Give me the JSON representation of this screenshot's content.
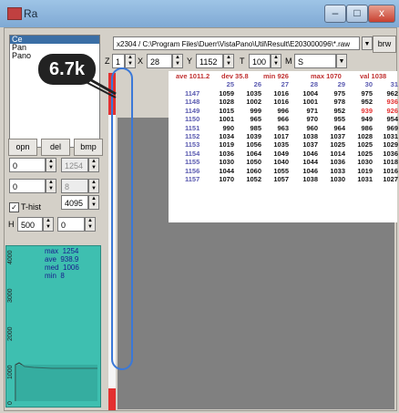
{
  "window": {
    "title": "Ra",
    "minimize_glyph": "–",
    "maximize_glyph": "□",
    "close_glyph": "x"
  },
  "colors": {
    "accent": "#3a6ea5",
    "value_red": "#e43030",
    "header_blue": "#3a3a9c",
    "histogram_bg": "#3ebfb0"
  },
  "file_list": [
    {
      "label": "Ce",
      "selected": true
    },
    {
      "label": "Pan",
      "selected": false
    },
    {
      "label": "Pano",
      "selected": false
    }
  ],
  "path_field": {
    "value": "x2304 / C:\\Program Files\\Duerr\\VistaPano\\Util\\Result\\E203000096\\*.raw"
  },
  "browse_button": {
    "label": "brw"
  },
  "params": {
    "z_label": "Z",
    "z_value": "1",
    "x_label": "X",
    "x_value": "28",
    "y_label": "Y",
    "y_value": "1152",
    "t_label": "T",
    "t_value": "100",
    "m_label": "M",
    "m_value": "S"
  },
  "buttons": {
    "open": "opn",
    "delete": "del",
    "bmp": "bmp"
  },
  "fields": {
    "field_a": "0",
    "field_b": "1254",
    "field_c": "0",
    "field_d": "8",
    "thist_label": "T-hist",
    "thist_checked": true,
    "thist_value": "4095",
    "h_label": "H",
    "h_value": "500",
    "h_offset": "0"
  },
  "histogram": {
    "max_label": "max",
    "max_value": "1254",
    "ave_label": "ave",
    "ave_value": "938.9",
    "med_label": "med",
    "med_value": "1006",
    "min_label": "min",
    "min_value": "8",
    "ticks": [
      "4000",
      "3000",
      "2000",
      "1000",
      "0"
    ]
  },
  "stats": {
    "ave_label": "ave",
    "ave_value": "1011.2",
    "dev_label": "dev",
    "dev_value": "35.8",
    "min_label": "min",
    "min_value": "926",
    "max_label": "max",
    "max_value": "1070",
    "val_label": "val",
    "val_value": "1038"
  },
  "table": {
    "columns": [
      "25",
      "26",
      "27",
      "28",
      "29",
      "30",
      "31"
    ],
    "rows": [
      {
        "id": "1147",
        "cells": [
          "1059",
          "1035",
          "1016",
          "1004",
          "975",
          "975",
          "962"
        ]
      },
      {
        "id": "1148",
        "cells": [
          "1028",
          "1002",
          "1016",
          "1001",
          "978",
          "952",
          "936"
        ]
      },
      {
        "id": "1149",
        "cells": [
          "1015",
          "999",
          "996",
          "971",
          "952",
          "939",
          "926"
        ]
      },
      {
        "id": "1150",
        "cells": [
          "1001",
          "965",
          "966",
          "970",
          "955",
          "949",
          "954"
        ]
      },
      {
        "id": "1151",
        "cells": [
          "990",
          "985",
          "963",
          "960",
          "964",
          "986",
          "969"
        ]
      },
      {
        "id": "1152",
        "cells": [
          "1034",
          "1039",
          "1017",
          "1038",
          "1037",
          "1028",
          "1031"
        ]
      },
      {
        "id": "1153",
        "cells": [
          "1019",
          "1056",
          "1035",
          "1037",
          "1025",
          "1025",
          "1029"
        ]
      },
      {
        "id": "1154",
        "cells": [
          "1036",
          "1064",
          "1049",
          "1046",
          "1014",
          "1025",
          "1036"
        ]
      },
      {
        "id": "1155",
        "cells": [
          "1030",
          "1050",
          "1040",
          "1044",
          "1036",
          "1030",
          "1018"
        ]
      },
      {
        "id": "1156",
        "cells": [
          "1044",
          "1060",
          "1055",
          "1046",
          "1033",
          "1019",
          "1016"
        ]
      },
      {
        "id": "1157",
        "cells": [
          "1070",
          "1052",
          "1057",
          "1038",
          "1030",
          "1031",
          "1027"
        ]
      }
    ],
    "red_cells": [
      [
        1,
        6
      ],
      [
        2,
        5
      ],
      [
        2,
        6
      ]
    ]
  },
  "annotation": {
    "badge_text": "6.7k"
  }
}
